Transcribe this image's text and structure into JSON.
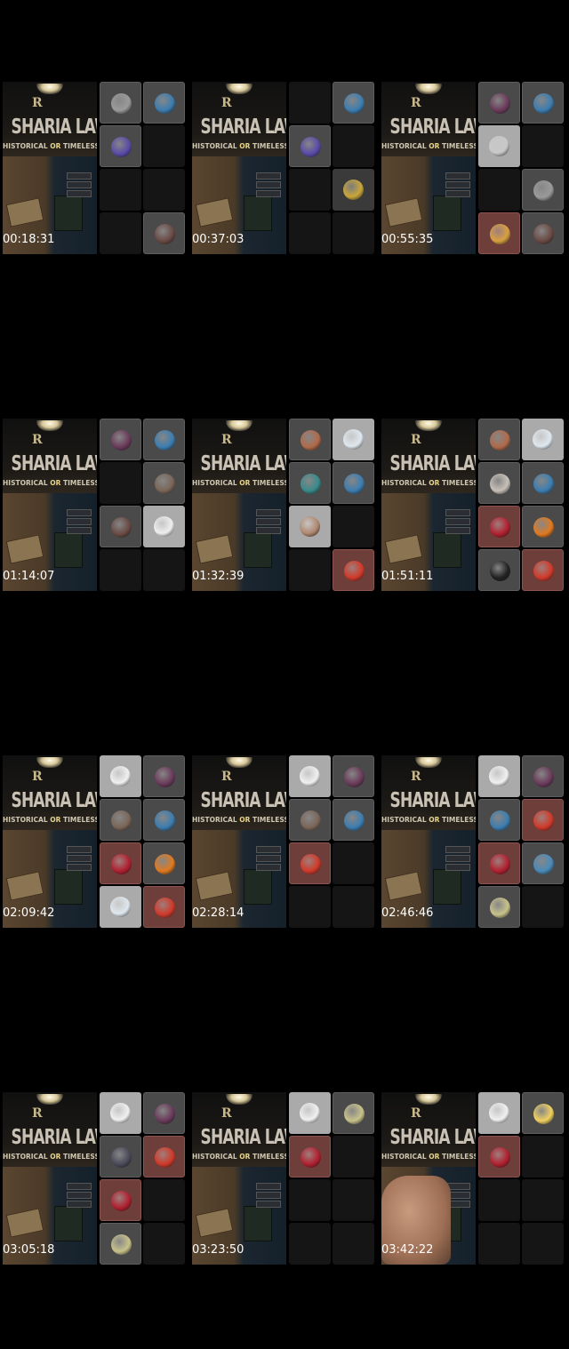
{
  "banner": {
    "logo": "R",
    "title": "SHARIA LAW",
    "subtitle_pre": "HISTORICAL ",
    "subtitle_or": "OR",
    "subtitle_post": " TIMELESS?"
  },
  "frames": [
    {
      "ts": "00:18:31",
      "cells": [
        {
          "s": "active",
          "c": "#9a9a9a"
        },
        {
          "s": "active",
          "c": "#3c7db0"
        },
        {
          "s": "active",
          "c": "#5a4aa8"
        },
        {
          "s": "empty"
        },
        {
          "s": "empty"
        },
        {
          "s": "empty"
        },
        {
          "s": "empty"
        },
        {
          "s": "active",
          "c": "#6a4a44"
        }
      ]
    },
    {
      "ts": "00:37:03",
      "cells": [
        {
          "s": "empty"
        },
        {
          "s": "active",
          "c": "#3c7db0"
        },
        {
          "s": "active",
          "c": "#5a4aa8"
        },
        {
          "s": "empty"
        },
        {
          "s": "empty"
        },
        {
          "s": "gold",
          "c": "#c9a63a"
        },
        {
          "s": "empty"
        },
        {
          "s": "empty"
        }
      ]
    },
    {
      "ts": "00:55:35",
      "cells": [
        {
          "s": "active",
          "c": "#6a3a5a"
        },
        {
          "s": "active",
          "c": "#3c7db0"
        },
        {
          "s": "light",
          "c": "#c8c8c8"
        },
        {
          "s": "empty"
        },
        {
          "s": "empty"
        },
        {
          "s": "active",
          "c": "#9a9a9a"
        },
        {
          "s": "red",
          "c": "#d8a040"
        },
        {
          "s": "active",
          "c": "#6a4a44"
        }
      ]
    },
    {
      "ts": "01:14:07",
      "cells": [
        {
          "s": "active",
          "c": "#6a3a5a"
        },
        {
          "s": "active",
          "c": "#3c7db0"
        },
        {
          "s": "empty"
        },
        {
          "s": "active",
          "c": "#7a6658"
        },
        {
          "s": "active",
          "c": "#6a4a44"
        },
        {
          "s": "light",
          "c": "#eeeeee"
        },
        {
          "s": "empty"
        },
        {
          "s": "empty"
        }
      ]
    },
    {
      "ts": "01:32:39",
      "cells": [
        {
          "s": "active",
          "c": "#b06a4a"
        },
        {
          "s": "light",
          "c": "#dfe8ef"
        },
        {
          "s": "active",
          "c": "#3a8a8a"
        },
        {
          "s": "active",
          "c": "#3c7db0"
        },
        {
          "s": "light",
          "c": "#b08870"
        },
        {
          "s": "empty"
        },
        {
          "s": "empty"
        },
        {
          "s": "red",
          "c": "#d03a2a"
        }
      ]
    },
    {
      "ts": "01:51:11",
      "cells": [
        {
          "s": "active",
          "c": "#b06a4a"
        },
        {
          "s": "light",
          "c": "#dfe8ef"
        },
        {
          "s": "active",
          "c": "#c8c0b8"
        },
        {
          "s": "active",
          "c": "#3c7db0"
        },
        {
          "s": "red",
          "c": "#b02030"
        },
        {
          "s": "active",
          "c": "#e07a20"
        },
        {
          "s": "active",
          "c": "#222222"
        },
        {
          "s": "red",
          "c": "#d03a2a"
        }
      ]
    },
    {
      "ts": "02:09:42",
      "cells": [
        {
          "s": "light",
          "c": "#f0f0f0"
        },
        {
          "s": "active",
          "c": "#6a3a5a"
        },
        {
          "s": "active",
          "c": "#7a6658"
        },
        {
          "s": "active",
          "c": "#3c7db0"
        },
        {
          "s": "red",
          "c": "#b02030"
        },
        {
          "s": "active",
          "c": "#e07a20"
        },
        {
          "s": "light",
          "c": "#dfe8ef"
        },
        {
          "s": "red",
          "c": "#d03a2a"
        }
      ]
    },
    {
      "ts": "02:28:14",
      "cells": [
        {
          "s": "light",
          "c": "#f0f0f0"
        },
        {
          "s": "active",
          "c": "#6a3a5a"
        },
        {
          "s": "active",
          "c": "#7a6658"
        },
        {
          "s": "active",
          "c": "#3c7db0"
        },
        {
          "s": "red",
          "c": "#d03a2a"
        },
        {
          "s": "empty"
        },
        {
          "s": "empty"
        },
        {
          "s": "empty"
        }
      ]
    },
    {
      "ts": "02:46:46",
      "cells": [
        {
          "s": "light",
          "c": "#f0f0f0"
        },
        {
          "s": "active",
          "c": "#6a3a5a"
        },
        {
          "s": "active",
          "c": "#3c7db0"
        },
        {
          "s": "red",
          "c": "#d03a2a"
        },
        {
          "s": "red",
          "c": "#b02030"
        },
        {
          "s": "active",
          "c": "#4a8ab8"
        },
        {
          "s": "active",
          "c": "#c8c28a"
        },
        {
          "s": "empty"
        }
      ]
    },
    {
      "ts": "03:05:18",
      "cells": [
        {
          "s": "light",
          "c": "#f0f0f0"
        },
        {
          "s": "active",
          "c": "#6a3a5a"
        },
        {
          "s": "active",
          "c": "#4a4a5a"
        },
        {
          "s": "red",
          "c": "#d03a2a"
        },
        {
          "s": "red",
          "c": "#b02030"
        },
        {
          "s": "empty"
        },
        {
          "s": "active",
          "c": "#c8c28a"
        },
        {
          "s": "empty"
        }
      ]
    },
    {
      "ts": "03:23:50",
      "cells": [
        {
          "s": "light",
          "c": "#f0f0f0"
        },
        {
          "s": "active",
          "c": "#c8c28a"
        },
        {
          "s": "red",
          "c": "#b02030"
        },
        {
          "s": "empty"
        },
        {
          "s": "empty"
        },
        {
          "s": "empty"
        },
        {
          "s": "empty"
        },
        {
          "s": "empty"
        }
      ]
    },
    {
      "ts": "03:42:22",
      "hand": true,
      "cells": [
        {
          "s": "light",
          "c": "#f0f0f0"
        },
        {
          "s": "active",
          "c": "#f0d060"
        },
        {
          "s": "red",
          "c": "#b02030"
        },
        {
          "s": "empty"
        },
        {
          "s": "empty"
        },
        {
          "s": "empty"
        },
        {
          "s": "empty"
        },
        {
          "s": "empty"
        }
      ]
    }
  ]
}
